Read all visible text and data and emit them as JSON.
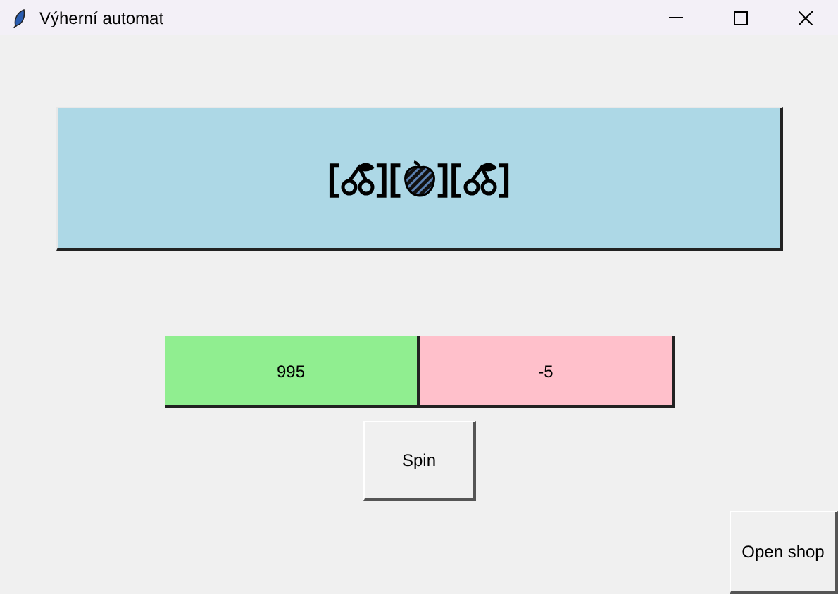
{
  "window": {
    "title": "Výherní automat"
  },
  "display": {
    "reels": [
      {
        "open": "[",
        "kind": "cherry",
        "close": "]"
      },
      {
        "open": "[",
        "kind": "peach",
        "close": "]"
      },
      {
        "open": "[",
        "kind": "cherry",
        "close": "]"
      }
    ]
  },
  "counters": [
    {
      "kind": "balance",
      "value": "995"
    },
    {
      "kind": "change",
      "value": "-5"
    }
  ],
  "spin_button": "Spin",
  "shop_button": "Open shop"
}
